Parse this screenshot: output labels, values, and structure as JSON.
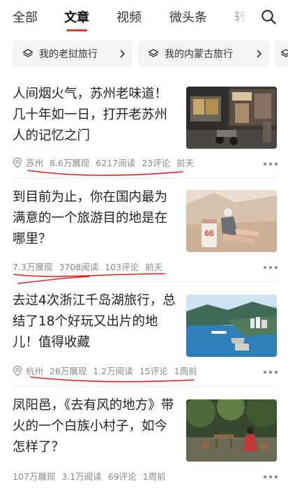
{
  "tabs": [
    {
      "label": "全部"
    },
    {
      "label": "文章"
    },
    {
      "label": "视频"
    },
    {
      "label": "微头条"
    },
    {
      "label": "转"
    }
  ],
  "active_tab": "文章",
  "accent_color": "#e8362c",
  "collections": [
    {
      "label": "我的老挝旅行",
      "icon": "stack-icon"
    },
    {
      "label": "我的内蒙古旅行",
      "icon": "stack-icon"
    }
  ],
  "articles": [
    {
      "title": "人间烟火气，苏州老味道！几十年如一日，打开老苏州人的记忆之门",
      "location": "苏州",
      "impressions": "8.6万展现",
      "reads": "6217阅读",
      "comments": "23评论",
      "time": "前天"
    },
    {
      "title": "到目前为止，你在国内最为满意的一个旅游目的地是在哪里？",
      "location": "",
      "impressions": "7.3万展现",
      "reads": "3708阅读",
      "comments": "103评论",
      "time": "前天",
      "thumb_text": "66"
    },
    {
      "title": "去过4次浙江千岛湖旅行，总结了18个好玩又出片的地儿！值得收藏",
      "location": "杭州",
      "impressions": "26万展现",
      "reads": "1.2万阅读",
      "comments": "15评论",
      "time": "1周前"
    },
    {
      "title": "凤阳邑，《去有风的地方》带火的一个白族小村子，如今怎样了？",
      "location": "",
      "impressions": "107万展现",
      "reads": "3.1万阅读",
      "comments": "69评论",
      "time": "1周前"
    }
  ]
}
